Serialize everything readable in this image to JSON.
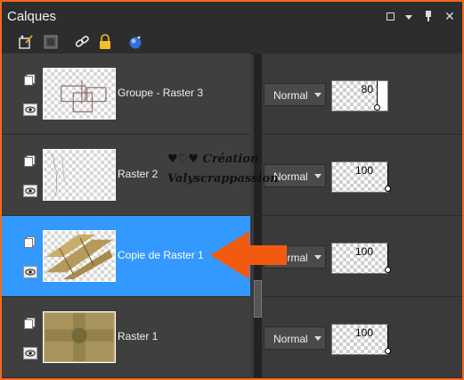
{
  "window": {
    "title": "Calques"
  },
  "toolbar": {
    "icons": [
      "new-layer-icon",
      "mask-icon",
      "link-icon",
      "lock-icon",
      "sphere-icon"
    ]
  },
  "layers": [
    {
      "name": "Groupe - Raster 3",
      "blend_mode": "Normal",
      "opacity": "80",
      "opacity_level": 0.8,
      "selected": false,
      "thumb": "frames"
    },
    {
      "name": "Raster 2",
      "blend_mode": "Normal",
      "opacity": "100",
      "opacity_level": 1.0,
      "selected": false,
      "thumb": "sketch"
    },
    {
      "name": "Copie de Raster 1",
      "blend_mode": "Normal",
      "opacity": "100",
      "opacity_level": 1.0,
      "selected": true,
      "thumb": "stripes"
    },
    {
      "name": "Raster 1",
      "blend_mode": "Normal",
      "opacity": "100",
      "opacity_level": 1.0,
      "selected": false,
      "thumb": "texture"
    }
  ],
  "watermark": {
    "line1": "♥♡♥ Création",
    "line2": "Valyscrappassion"
  },
  "colors": {
    "accent_selected": "#3399ff",
    "arrow": "#f25a0f",
    "border": "#f26a1b"
  }
}
